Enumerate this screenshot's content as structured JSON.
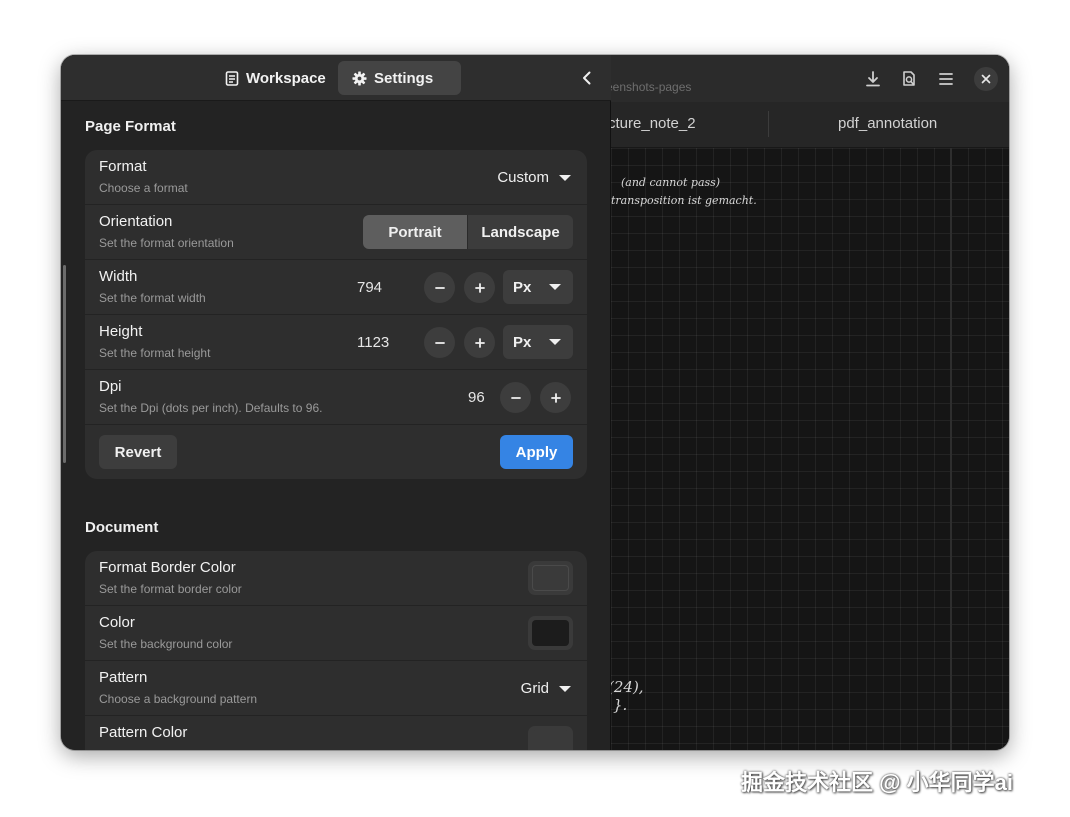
{
  "document": {
    "path_text": "eenshots-pages",
    "tabs": [
      {
        "label": "cture_note_2"
      },
      {
        "label": "pdf_annotation"
      }
    ],
    "handwriting": [
      "(and cannot pass)",
      "transposition ist gemacht.",
      "(24),",
      "}."
    ]
  },
  "sidebar": {
    "tabs": [
      {
        "label": "Workspace",
        "icon": "document-icon",
        "active": false
      },
      {
        "label": "Settings",
        "icon": "gear-icon",
        "active": true
      }
    ],
    "back_icon": "chevron-left-icon"
  },
  "page_format": {
    "title": "Page Format",
    "format": {
      "title": "Format",
      "subtitle": "Choose a format",
      "value": "Custom"
    },
    "orientation": {
      "title": "Orientation",
      "subtitle": "Set the format orientation",
      "options": [
        "Portrait",
        "Landscape"
      ],
      "selected": "Portrait"
    },
    "width": {
      "title": "Width",
      "subtitle": "Set the format width",
      "value": "794",
      "unit": "Px"
    },
    "height": {
      "title": "Height",
      "subtitle": "Set the format height",
      "value": "1123",
      "unit": "Px"
    },
    "dpi": {
      "title": "Dpi",
      "subtitle": "Set the Dpi (dots per inch). Defaults to 96.",
      "value": "96"
    },
    "revert_label": "Revert",
    "apply_label": "Apply"
  },
  "document_section": {
    "title": "Document",
    "border_color": {
      "title": "Format Border Color",
      "subtitle": "Set the format border color",
      "color": "#3a3a3a"
    },
    "color": {
      "title": "Color",
      "subtitle": "Set the background color",
      "color": "#1c1c1c"
    },
    "pattern": {
      "title": "Pattern",
      "subtitle": "Choose a background pattern",
      "value": "Grid"
    },
    "pattern_color": {
      "title": "Pattern Color",
      "color": "#3a3a3a"
    }
  },
  "watermark": "掘金技术社区 @ 小华同学ai",
  "colors": {
    "accent": "#3584e4",
    "sidebar_bg": "#232323",
    "card_bg": "#2e2e2e"
  }
}
